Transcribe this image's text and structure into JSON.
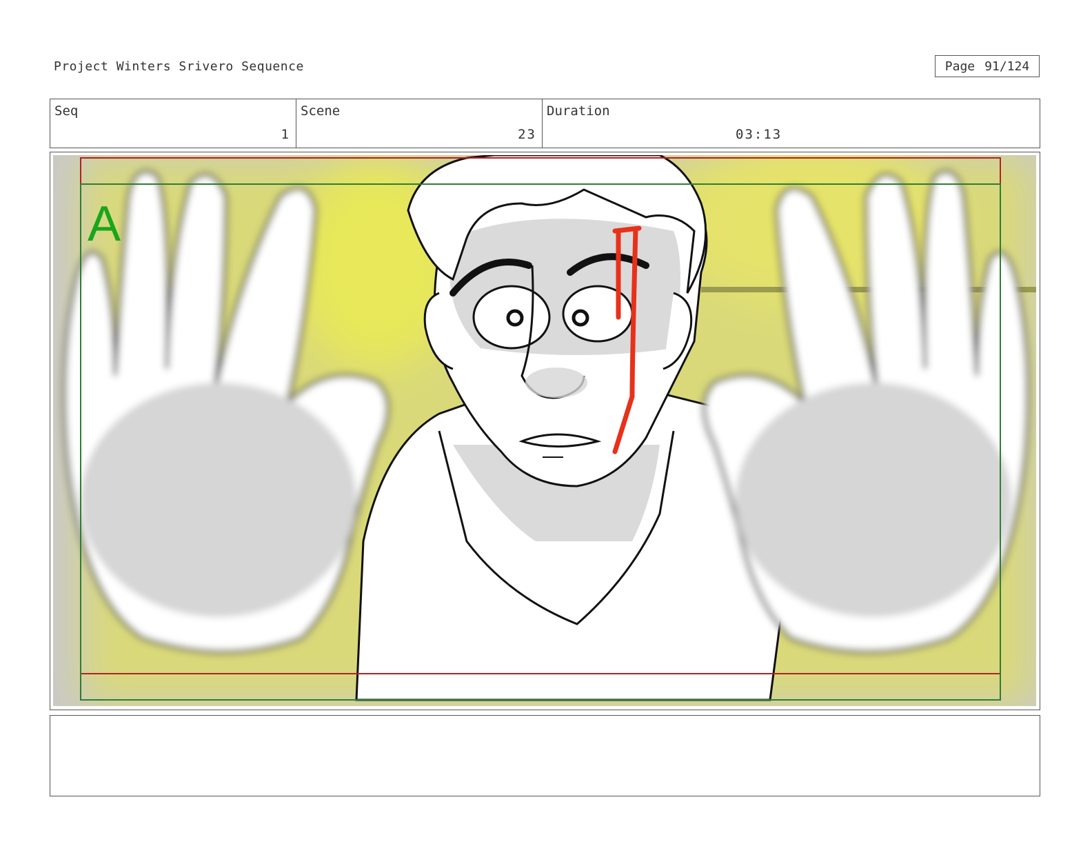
{
  "header": {
    "project_title": "Project Winters Srivero Sequence",
    "page_label": "Page",
    "page_number": "91/124"
  },
  "info": {
    "seq_label": "Seq",
    "seq_value": "1",
    "scene_label": "Scene",
    "scene_value": "23",
    "duration_label": "Duration",
    "duration_value": "03:13"
  },
  "panel": {
    "panel_letter": "A",
    "safe_frame_colors": {
      "action_safe": "#b22222",
      "title_safe": "#2e7d32"
    },
    "sketch_colors": {
      "background": "#d9d97a",
      "line": "#111111",
      "shadow": "#d6d6d6",
      "accent": "#e8311a"
    }
  },
  "notes": {
    "text": ""
  }
}
